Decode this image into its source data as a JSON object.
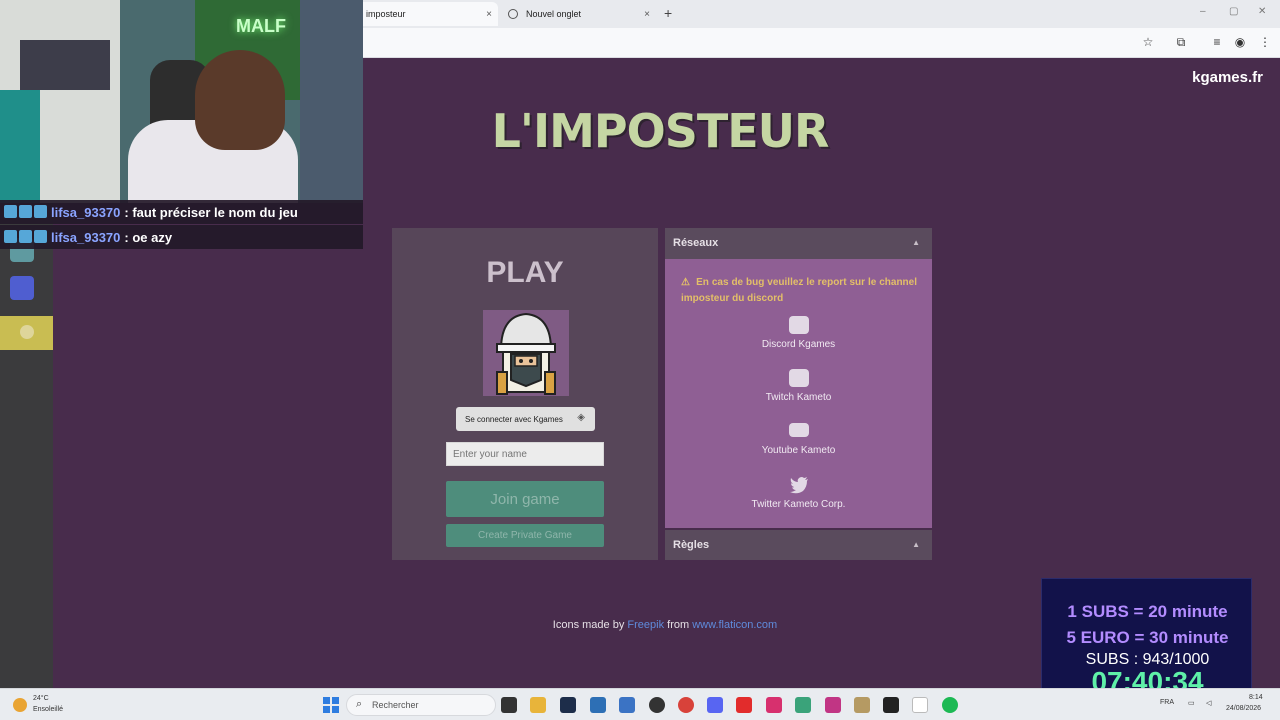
{
  "browser": {
    "tabs": [
      {
        "label": "imposteur",
        "active": true
      },
      {
        "label": "Nouvel onglet",
        "active": false
      }
    ],
    "new_tab": "+",
    "close_glyph": "×",
    "window_controls": [
      "–",
      "▢",
      "✕"
    ],
    "toolbar_icons": [
      "star-icon",
      "extensions-icon",
      "media-icon",
      "profile-icon",
      "menu-icon"
    ]
  },
  "site": {
    "brand": "kgames.fr",
    "title": "L'IMPOSTEUR",
    "play": {
      "heading": "PLAY",
      "connect_label": "Se connecter avec Kgames",
      "name_placeholder": "Enter your name",
      "join_label": "Join game",
      "private_label": "Create Private Game"
    },
    "reseaux": {
      "heading": "Réseaux",
      "warning": "En cas de bug veuillez le report sur le channel imposteur du discord",
      "links": [
        {
          "label": "Discord Kgames",
          "icon": "discord-icon"
        },
        {
          "label": "Twitch Kameto",
          "icon": "twitch-icon"
        },
        {
          "label": "Youtube Kameto",
          "icon": "youtube-icon"
        },
        {
          "label": "Twitter Kameto Corp.",
          "icon": "twitter-icon"
        }
      ]
    },
    "regles": {
      "heading": "Règles"
    },
    "credit": {
      "prefix": "Icons made by",
      "author": "Freepik",
      "mid": "from",
      "site": "www.flaticon.com"
    }
  },
  "overlay": {
    "cam_neon": "MALF",
    "chat": [
      {
        "user": "lifsa_93370",
        "message": ": faut préciser le nom du jeu"
      },
      {
        "user": "lifsa_93370",
        "message": ": oe azy"
      }
    ],
    "subs": {
      "line1": "1 SUBS = 20 minute",
      "line2": "5 EURO = 30 minute",
      "line3": "SUBS : 943/1000",
      "timer": "07:40:34"
    }
  },
  "taskbar": {
    "weather_temp": "24°C",
    "weather_desc": "Ensoleillé",
    "search_placeholder": "Rechercher",
    "lang": "FRA",
    "time": "8:14",
    "date": "24/08/2026",
    "colors": {
      "accent": "#2f7de0"
    }
  }
}
